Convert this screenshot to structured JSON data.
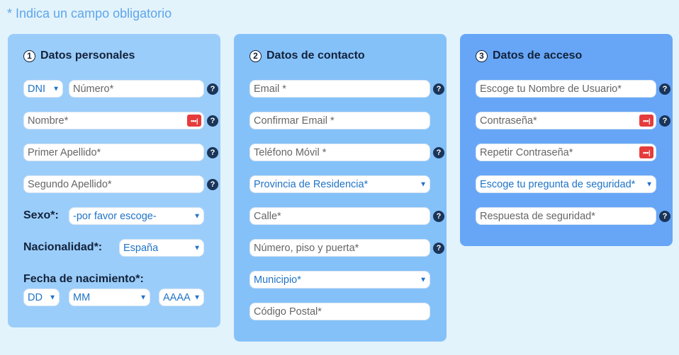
{
  "required_note": "* Indica un campo obligatorio",
  "panel1": {
    "step": "1",
    "title": "Datos personales",
    "doc_type": "DNI",
    "numero_placeholder": "Número*",
    "nombre_placeholder": "Nombre*",
    "primer_apellido_placeholder": "Primer Apellido*",
    "segundo_apellido_placeholder": "Segundo Apellido*",
    "sexo_label": "Sexo*:",
    "sexo_value": "-por favor escoge-",
    "nacionalidad_label": "Nacionalidad*:",
    "nacionalidad_value": "España",
    "fecha_label": "Fecha de nacimiento*:",
    "dd": "DD",
    "mm": "MM",
    "aaaa": "AAAA"
  },
  "panel2": {
    "step": "2",
    "title": "Datos de contacto",
    "email_placeholder": "Email *",
    "confirm_email_placeholder": "Confirmar Email *",
    "telefono_placeholder": "Teléfono Móvil *",
    "provincia_value": "Provincia de Residencia*",
    "calle_placeholder": "Calle*",
    "numero_piso_placeholder": "Número, piso y puerta*",
    "municipio_value": "Municipio*",
    "codigo_postal_placeholder": "Código Postal*"
  },
  "panel3": {
    "step": "3",
    "title": "Datos de acceso",
    "usuario_placeholder": "Escoge tu Nombre de Usuario*",
    "contrasena_placeholder": "Contraseña*",
    "repetir_contrasena_placeholder": "Repetir Contraseña*",
    "pregunta_value": "Escoge tu pregunta de seguridad*",
    "respuesta_placeholder": "Respuesta de seguridad*"
  },
  "icons": {
    "help": "?",
    "password_dots": "•••|",
    "chevron": "▼"
  },
  "colors": {
    "page_bg": "#e3f3fc",
    "panel1_bg": "#9bcdfa",
    "panel2_bg": "#85c1f9",
    "panel3_bg": "#67a6f7",
    "accent_text": "#1f73c7",
    "help_icon_bg": "#1a3559",
    "password_icon_bg": "#e63b3b"
  }
}
